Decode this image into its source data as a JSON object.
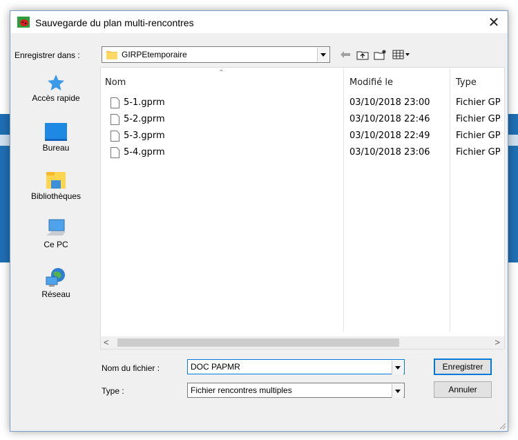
{
  "dialog": {
    "title": "Sauvegarde du plan multi-rencontres",
    "close_symbol": "✕"
  },
  "location": {
    "label": "Enregistrer dans :",
    "value": "GIRPEtemporaire"
  },
  "toolbar": {
    "icons": [
      "back-arrow-icon",
      "up-folder-icon",
      "new-folder-icon",
      "view-menu-icon"
    ]
  },
  "places": [
    {
      "label": "Accès rapide",
      "icon": "quick-access-star-icon"
    },
    {
      "label": "Bureau",
      "icon": "desktop-icon"
    },
    {
      "label": "Bibliothèques",
      "icon": "libraries-icon"
    },
    {
      "label": "Ce PC",
      "icon": "this-pc-icon"
    },
    {
      "label": "Réseau",
      "icon": "network-icon"
    }
  ],
  "filelist": {
    "columns": [
      "Nom",
      "Modifié le",
      "Type"
    ],
    "rows": [
      {
        "name": "5-1.gprm",
        "modified": "03/10/2018 23:00",
        "type": "Fichier GP"
      },
      {
        "name": "5-2.gprm",
        "modified": "03/10/2018 22:46",
        "type": "Fichier GP"
      },
      {
        "name": "5-3.gprm",
        "modified": "03/10/2018 22:49",
        "type": "Fichier GP"
      },
      {
        "name": "5-4.gprm",
        "modified": "03/10/2018 23:06",
        "type": "Fichier GP"
      }
    ]
  },
  "form": {
    "filename_label": "Nom du fichier :",
    "filename_value": "DOC PAPMR",
    "type_label": "Type :",
    "type_value": "Fichier rencontres multiples"
  },
  "buttons": {
    "save": "Enregistrer",
    "cancel": "Annuler"
  },
  "colors": {
    "accent": "#0078d7",
    "background_app": "#1f6fb4"
  }
}
